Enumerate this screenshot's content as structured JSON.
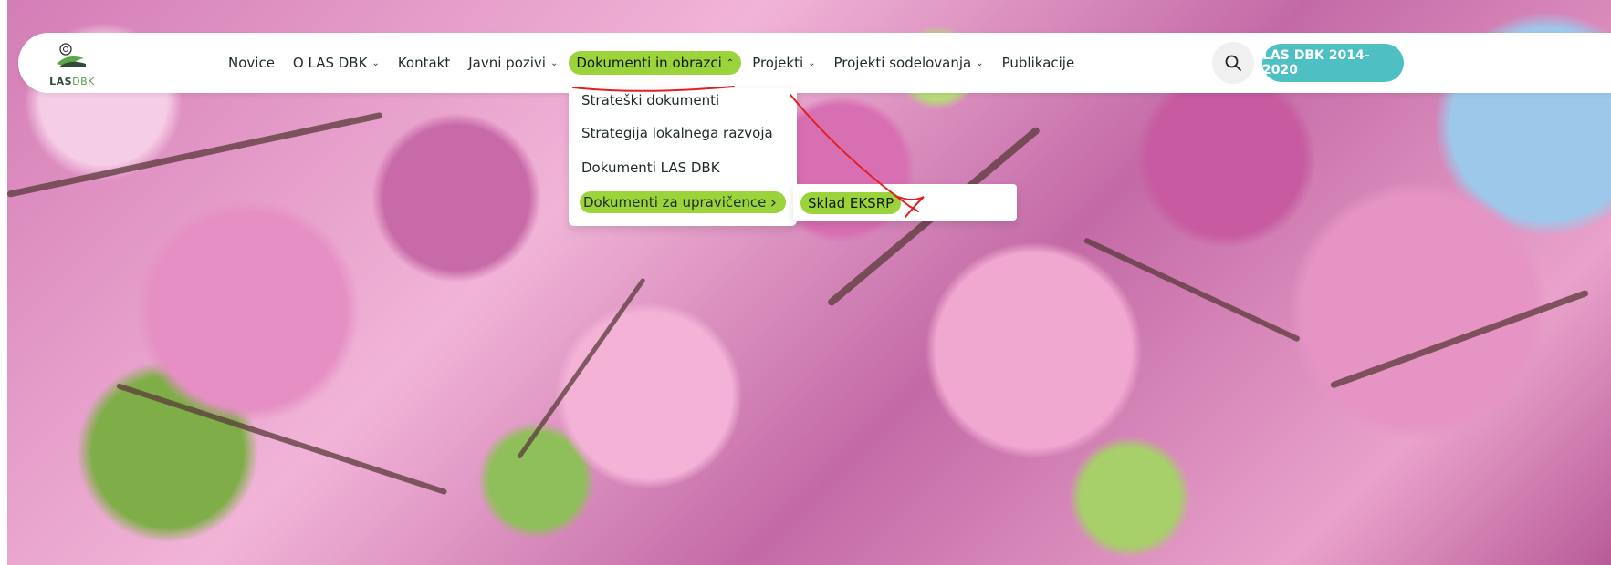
{
  "logo": {
    "text_bold": "LAS",
    "text_light": "DBK"
  },
  "nav": {
    "items": [
      {
        "label": "Novice",
        "chevron": ""
      },
      {
        "label": "O LAS DBK",
        "chevron": "⌄"
      },
      {
        "label": "Kontakt",
        "chevron": ""
      },
      {
        "label": "Javni pozivi",
        "chevron": "⌄"
      },
      {
        "label": "Dokumenti in obrazci",
        "chevron": "⌃"
      },
      {
        "label": "Projekti",
        "chevron": "⌄"
      },
      {
        "label": "Projekti sodelovanja",
        "chevron": "⌄"
      },
      {
        "label": "Publikacije",
        "chevron": ""
      }
    ]
  },
  "header_actions": {
    "search_icon": "search-icon",
    "cta_label": "LAS DBK 2014-2020"
  },
  "dropdown": {
    "items": [
      "Strateški dokumenti",
      "Strategija lokalnega razvoja",
      "Dokumenti LAS DBK",
      "Dokumenti za upravičence"
    ],
    "active_chevron": "›"
  },
  "submenu": {
    "items": [
      "Sklad EKSRP"
    ]
  },
  "colors": {
    "accent_green": "#9bd43a",
    "cta_teal": "#4ec0c4",
    "annotation_red": "#e02020"
  }
}
